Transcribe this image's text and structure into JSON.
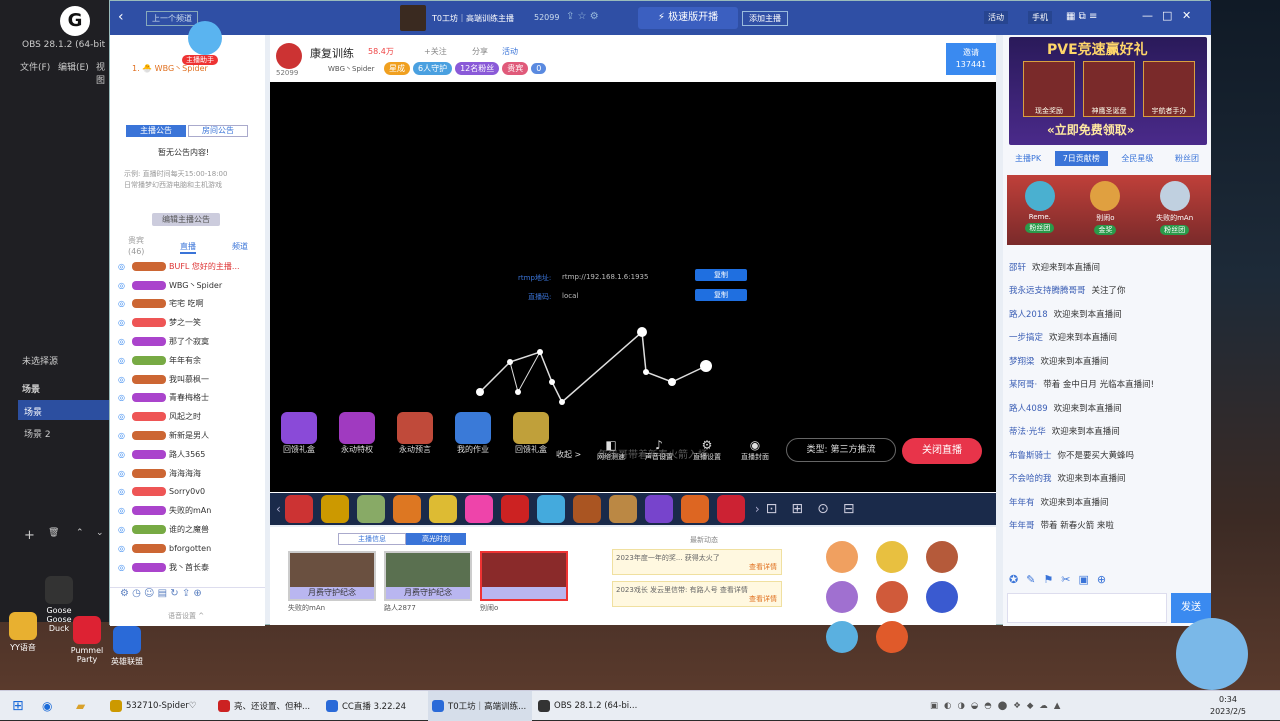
{
  "obs": {
    "title": "OBS 28.1.2 (64-bit",
    "menu_file": "文件(F)",
    "menu_edit": "编辑(E)",
    "menu_view": "视图",
    "scenes_unsaved": "未选择源",
    "scenes_header": "场景",
    "scene_1": "场景",
    "scene_2": "场景 2",
    "add": "+",
    "delete": "🗑",
    "up": "⌃",
    "down": "⌄"
  },
  "topbar": {
    "back": "‹",
    "prev_stream": "上一个频道",
    "room_title": "T0工坊｜高端训练主播",
    "room_id": "52099",
    "fast_stream": "极速版开播",
    "add_host": "添加主播",
    "tool_left": "活动",
    "tool_mobile": "手机",
    "win_min": "—",
    "win_max": "□",
    "win_close": "✕"
  },
  "left": {
    "tab_announce": "主播公告",
    "tab_room": "房间公告",
    "announce_title": "暂无公告内容!",
    "announce_body": "示例: 直播时间每天15:00-18:00\n日常播梦幻西游电脑和主机游戏",
    "edit_announce": "编辑主播公告",
    "audience_label": "贵宾",
    "audience_count": "(46)",
    "tab_live": "直播",
    "tab_channel": "频道",
    "helper": "主播助手",
    "top_user": "1. 🐣 WBG丶Spider",
    "bottom_settings": "语音设置 ^",
    "viewers": [
      {
        "name": "BUFL 您好的主播...",
        "color": "#d33"
      },
      {
        "name": "WBG丶Spider",
        "color": "#333"
      },
      {
        "name": "宅宅 吃啊",
        "color": "#333"
      },
      {
        "name": "梦之一笑",
        "color": "#333"
      },
      {
        "name": "那了个寂寞",
        "color": "#333"
      },
      {
        "name": "年年有余",
        "color": "#333"
      },
      {
        "name": "我叫慕枫一",
        "color": "#333"
      },
      {
        "name": "青春梅格士",
        "color": "#333"
      },
      {
        "name": "风起之时",
        "color": "#333"
      },
      {
        "name": "新新是男人",
        "color": "#333"
      },
      {
        "name": "路人3565",
        "color": "#333"
      },
      {
        "name": "海海海海",
        "color": "#333"
      },
      {
        "name": "Sorry0v0",
        "color": "#333"
      },
      {
        "name": "失败的mAn",
        "color": "#333"
      },
      {
        "name": "谁的之魔兽",
        "color": "#333"
      },
      {
        "name": "bforgotten",
        "color": "#333"
      },
      {
        "name": "我丶酋长泰",
        "color": "#333"
      }
    ]
  },
  "stage": {
    "host_name": "康复训练",
    "host_id": "52099",
    "fans": "58.4万",
    "follow": "+关注",
    "share": "分享",
    "activity": "活动",
    "sub_name": "WBG丶Spider",
    "chips": [
      {
        "label": "星成",
        "color": "#f0a020"
      },
      {
        "label": "6人守护",
        "color": "#4aa0e0"
      },
      {
        "label": "12名粉丝",
        "color": "#8a5ad8"
      },
      {
        "label": "贵宾",
        "color": "#e05a7a"
      },
      {
        "label": "0",
        "color": "#5a8ae0"
      }
    ],
    "invite_label": "邀请",
    "invite_count": "137441",
    "rtmp_label": "rtmp地址:",
    "rtmp_value": "rtmp://192.168.1.6:1935",
    "key_label": "直播码:",
    "key_value": "local",
    "copy1": "复制",
    "copy2": "复制",
    "bottom_left": [
      {
        "label": "回馈礼盒"
      },
      {
        "label": "永动特权"
      },
      {
        "label": "永动预言"
      },
      {
        "label": "我的作业"
      },
      {
        "label": "回馈礼盒"
      }
    ],
    "collapse": "收起 >",
    "ticker": "年年哥带着新春火箭入场",
    "controls": [
      {
        "label": "网络测速"
      },
      {
        "label": "声音设置"
      },
      {
        "label": "直播设置"
      },
      {
        "label": "直播封面"
      }
    ],
    "type_label": "类型: 第三方推流",
    "close_live": "关闭直播"
  },
  "below": {
    "tab_info": "主播信息",
    "tab_highlight": "高光时刻",
    "latest": "最新动态",
    "clips": [
      {
        "label": "月费守护纪念",
        "user": "失败的mAn"
      },
      {
        "label": "月费守护纪念",
        "user": "路人2877"
      },
      {
        "label": "",
        "user": "别闹o"
      }
    ],
    "news": [
      {
        "text": "2023年度一年的奖...   获得太火了",
        "link": "查看详情"
      },
      {
        "text": "2023戏长   发云里信带: 有路人号     查看详情",
        "link": "查看详情"
      }
    ]
  },
  "right": {
    "banner_title": "PVE竞速赢好礼",
    "banner_cta": "«立即免费领取»",
    "banner_items": [
      "现金奖励",
      "神鹰圣诞盘",
      "宇航者手办"
    ],
    "tabs": [
      "主播PK",
      "7日贡献榜",
      "全民星级",
      "粉丝团"
    ],
    "rank": [
      {
        "name": "Reme.",
        "tag": "粉丝团"
      },
      {
        "name": "别闹o",
        "tag": "金奖"
      },
      {
        "name": "失败的mAn",
        "tag": "粉丝团"
      }
    ],
    "messages": [
      {
        "name": "邵轩",
        "text": "欢迎来到本直播间"
      },
      {
        "name": "我永远支持腾腾哥哥",
        "text": "关注了你"
      },
      {
        "name": "路人2018",
        "text": "欢迎来到本直播间"
      },
      {
        "name": "一步搞定",
        "text": "欢迎来到本直播间"
      },
      {
        "name": "梦翔梁",
        "text": "欢迎来到本直播间"
      },
      {
        "name": "某阿哥·",
        "text": "带着 金中日月 光临本直播间!"
      },
      {
        "name": "路人4089",
        "text": "欢迎来到本直播间"
      },
      {
        "name": "蒂法·光华",
        "text": "欢迎来到本直播间"
      },
      {
        "name": "布鲁斯骑士",
        "text": "你不是要买大黄蜂吗"
      },
      {
        "name": "不会哈的我",
        "text": "欢迎来到本直播间"
      },
      {
        "name": "年年有",
        "text": "欢迎来到本直播间"
      },
      {
        "name": "年年哥",
        "text": "带着 新春火箭 来啦"
      }
    ],
    "send": "发送"
  },
  "desktop_icons": [
    {
      "label": "Goose Goose Duck"
    },
    {
      "label": "Pummel Party"
    },
    {
      "label": "英雄联盟"
    },
    {
      "label": "YY语音"
    }
  ],
  "taskbar": {
    "apps": [
      {
        "label": "532710-Spider♡"
      },
      {
        "label": "亮、还设置、但种..."
      },
      {
        "label": "CC直播 3.22.24"
      },
      {
        "label": "T0工坊｜高端训练..."
      },
      {
        "label": "OBS 28.1.2 (64-bi..."
      }
    ],
    "time": "0:34",
    "date": "2023/2/5"
  },
  "colors": {
    "brand": "#2f4fa5",
    "close_live": "#e8344a",
    "copy_btn": "#1f6fe0",
    "send": "#3a8af0"
  }
}
